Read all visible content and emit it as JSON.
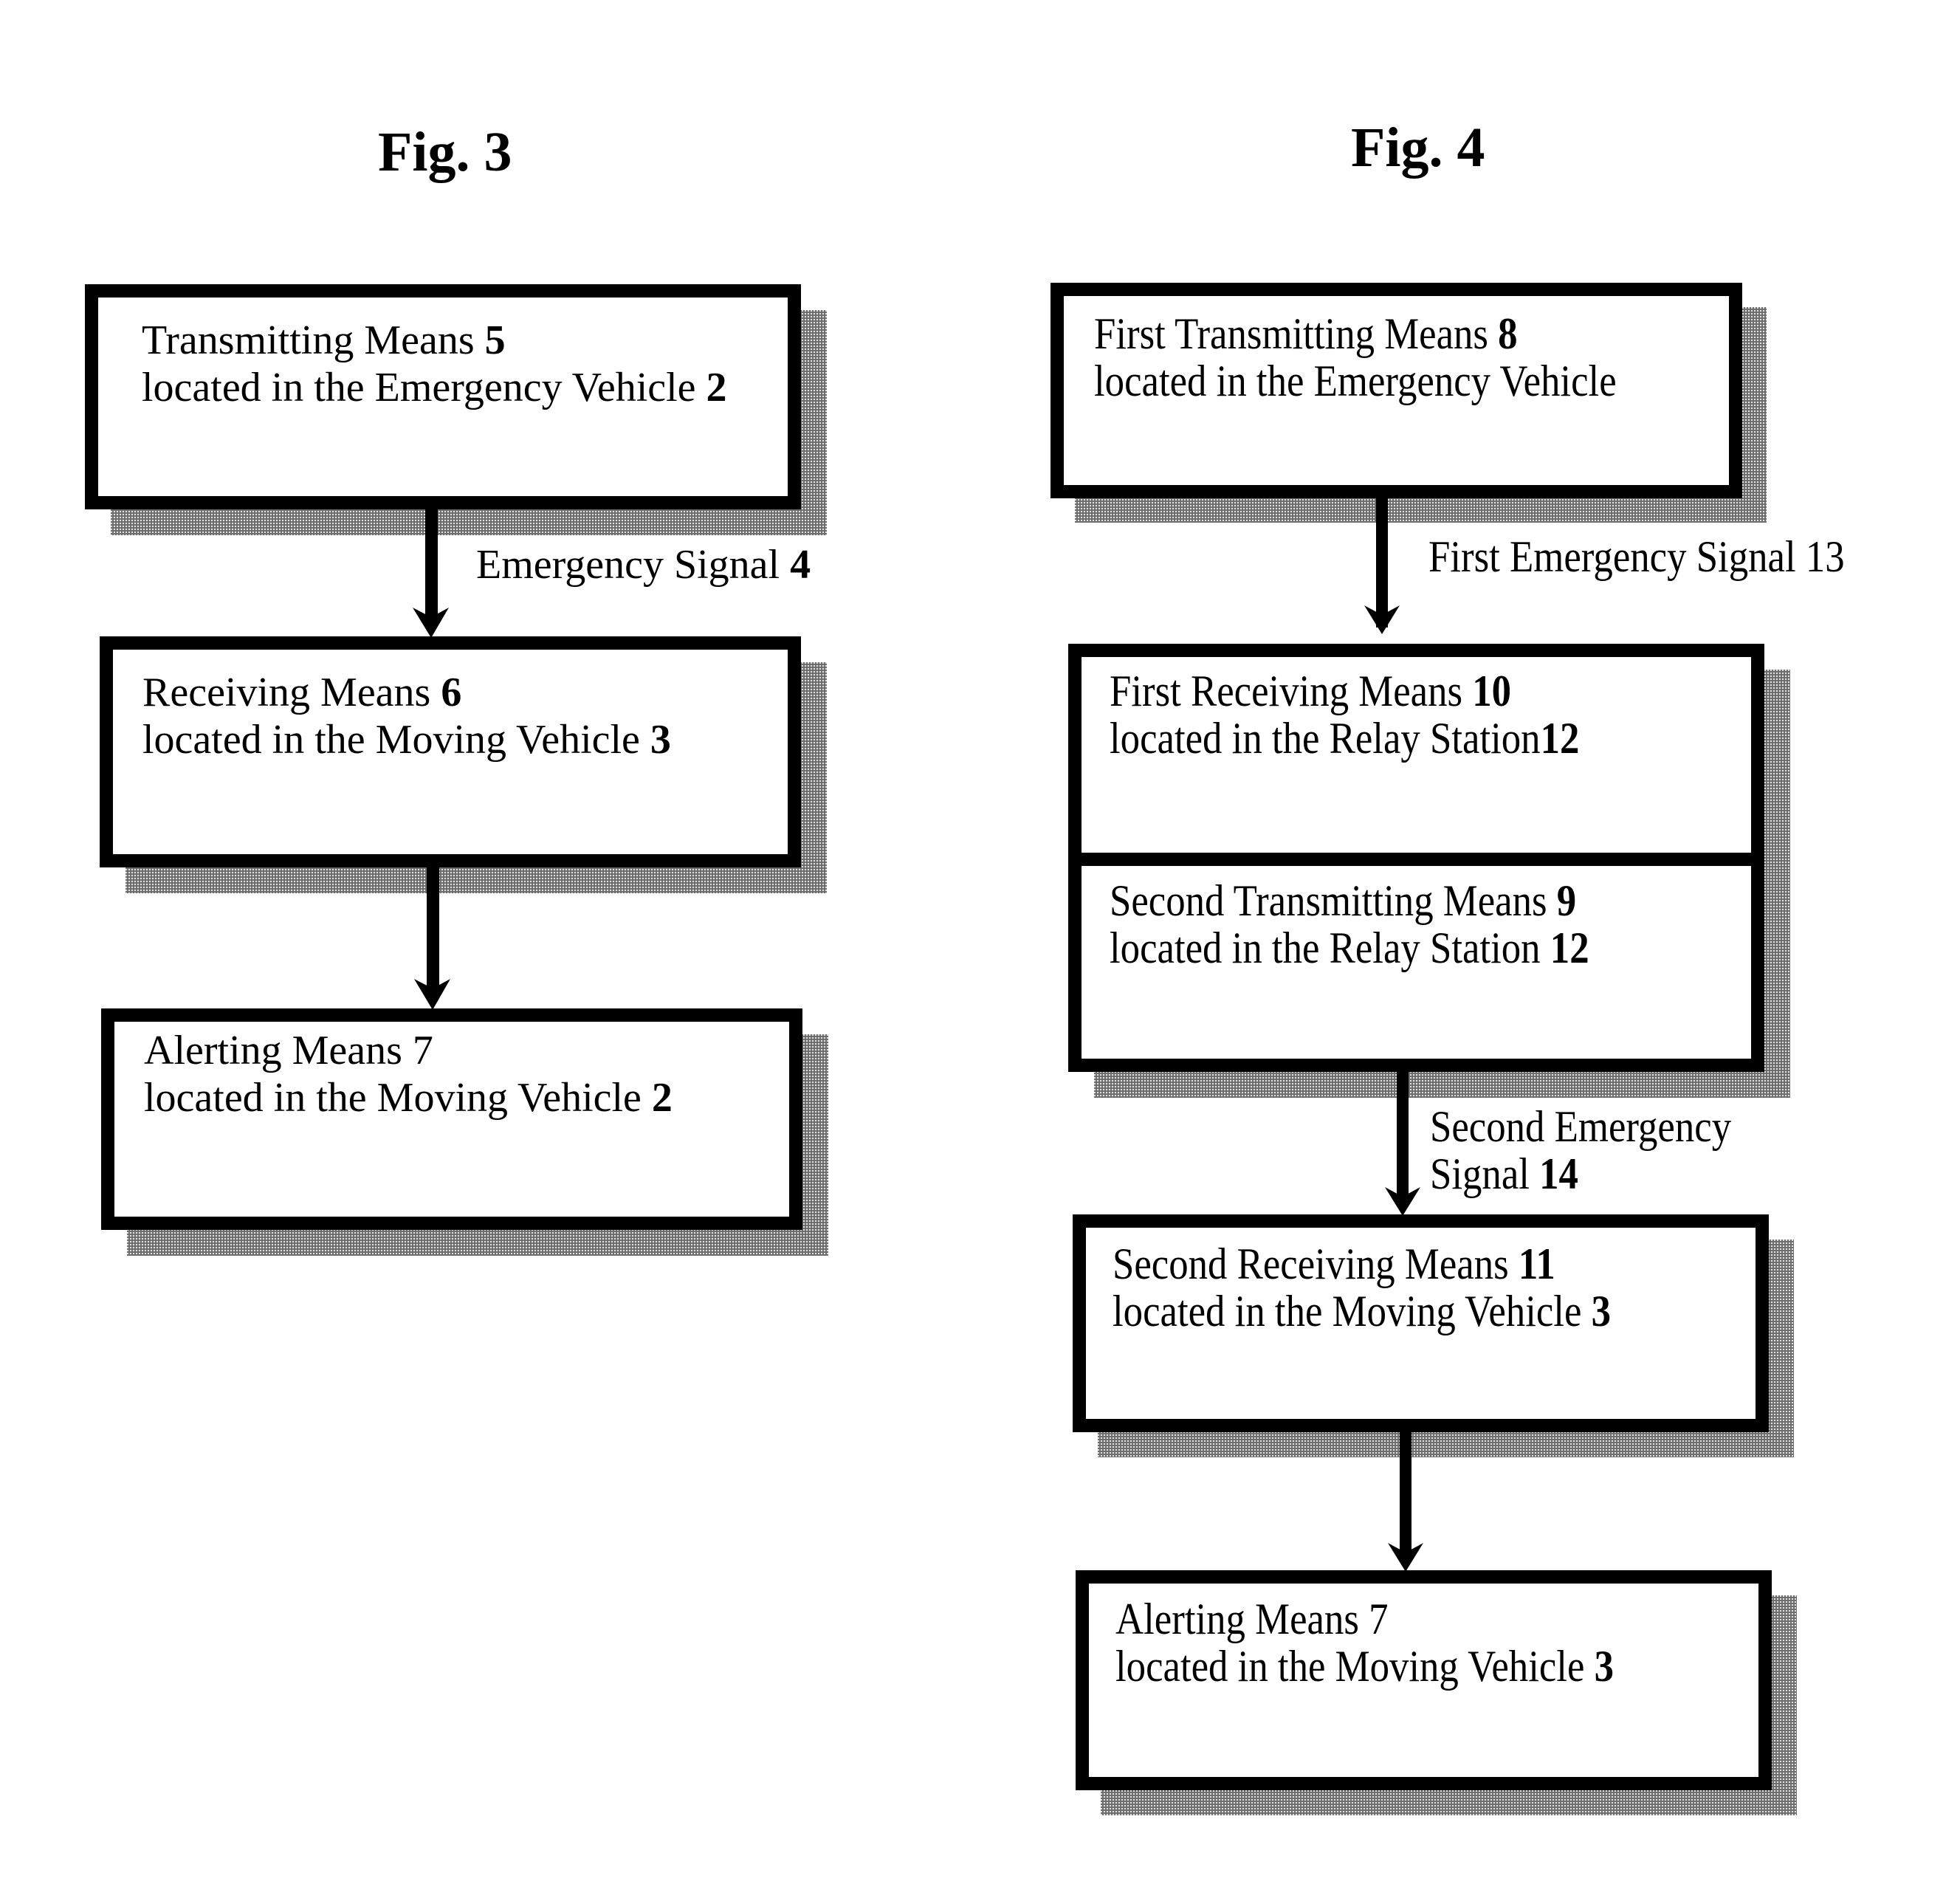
{
  "fig3": {
    "title": "Fig. 3",
    "blocks": [
      {
        "line1": "Transmitting Means ",
        "line1_num": "5",
        "line2": "located in the Emergency Vehicle ",
        "line2_num": "2"
      },
      {
        "line1": "Receiving Means ",
        "line1_num": "6",
        "line2": "located in the Moving Vehicle ",
        "line2_num": "3"
      },
      {
        "line1": "Alerting Means ",
        "line1_num": "7",
        "line2": "located in the Moving Vehicle ",
        "line2_num": "2"
      }
    ],
    "signals": [
      {
        "text": "Emergency Signal ",
        "num": "4"
      }
    ]
  },
  "fig4": {
    "title": "Fig. 4",
    "blocks": [
      {
        "line1": "First Transmitting Means ",
        "line1_num": "8",
        "line2": "located in the Emergency Vehicle",
        "line2_num": ""
      },
      {
        "line1": "First Receiving Means ",
        "line1_num": "10",
        "line2": "located in the Relay Station",
        "line2_num": "12"
      },
      {
        "line1": "Second Transmitting Means ",
        "line1_num": "9",
        "line2": "located in the Relay Station ",
        "line2_num": "12"
      },
      {
        "line1": "Second Receiving Means ",
        "line1_num": "11",
        "line2": "located in the Moving Vehicle ",
        "line2_num": "3"
      },
      {
        "line1": "Alerting Means ",
        "line1_num": "7",
        "line2": "located in the Moving Vehicle ",
        "line2_num": "3"
      }
    ],
    "signals": [
      {
        "text": "First Emergency Signal ",
        "num": "13"
      },
      {
        "text_line1": "Second Emergency",
        "text_line2": "Signal ",
        "num": "14"
      }
    ]
  }
}
